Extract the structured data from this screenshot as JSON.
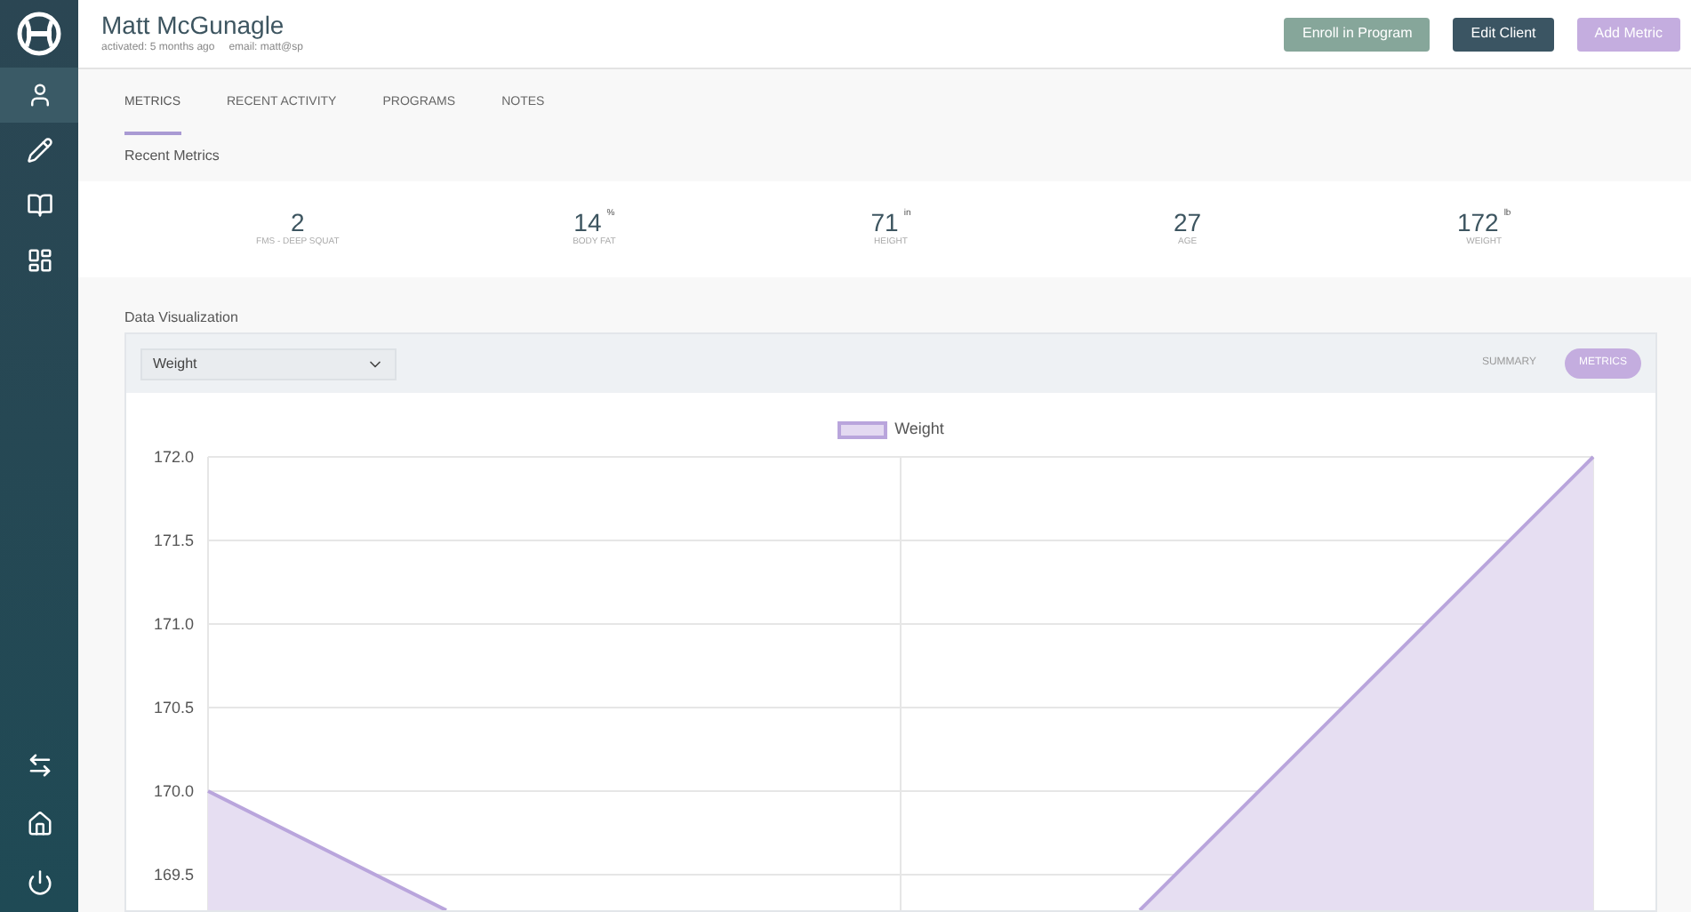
{
  "nav": [
    {
      "kind": "person",
      "selected": true
    },
    {
      "kind": "pencil",
      "selected": false
    },
    {
      "kind": "book",
      "selected": false
    },
    {
      "kind": "dashboard",
      "selected": false
    }
  ],
  "client": {
    "name": "Matt McGunagle",
    "activated": "activated: 5 months ago",
    "email": "email: matt@sp"
  },
  "actions": [
    {
      "label": "Enroll in Program",
      "kind": "enroll"
    },
    {
      "label": "Edit Client",
      "kind": "edit"
    },
    {
      "label": "Add Metric",
      "kind": "add"
    }
  ],
  "tabs": [
    {
      "label": "METRICS",
      "selected": true
    },
    {
      "label": "RECENT ACTIVITY",
      "selected": false
    },
    {
      "label": "PROGRAMS",
      "selected": false
    },
    {
      "label": "NOTES",
      "selected": false
    }
  ],
  "recent_metrics": {
    "title": "Recent Metrics",
    "items": [
      {
        "value": "2",
        "label": "FMS - DEEP SQUAT"
      },
      {
        "value": "14",
        "unit": "%",
        "label": "BODY FAT"
      },
      {
        "value": "71",
        "unit": "in",
        "label": "HEIGHT"
      },
      {
        "value": "27",
        "label": "AGE"
      },
      {
        "value": "172",
        "unit": "lb",
        "label": "WEIGHT"
      }
    ]
  },
  "data_visualization": {
    "title": "Data Visualization",
    "metric_select": "Weight",
    "view_toggle": [
      {
        "label": "SUMMARY",
        "selected": false
      },
      {
        "label": "METRICS",
        "selected": true
      }
    ],
    "chart": {
      "legend": "Weight",
      "y_labels": [
        "172.0",
        "171.5",
        "171.0",
        "170.5",
        "170.0",
        "169.5"
      ]
    }
  }
}
